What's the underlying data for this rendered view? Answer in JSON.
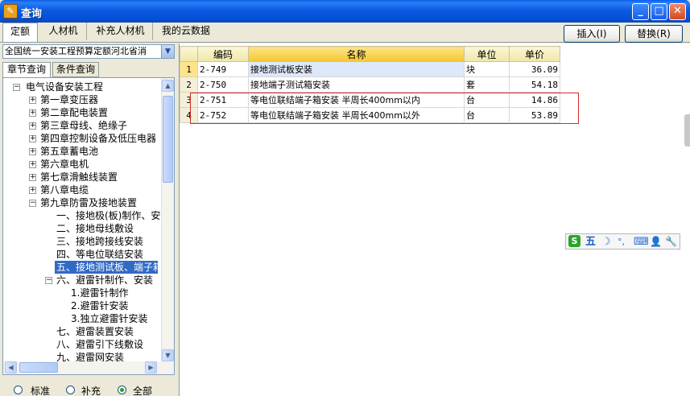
{
  "window": {
    "title": "查询",
    "minimize": "_",
    "maximize": "□",
    "close": "✕"
  },
  "tabs": [
    {
      "label": "定额",
      "active": true
    },
    {
      "label": "人材机",
      "active": false
    },
    {
      "label": "补充人材机",
      "active": false
    },
    {
      "label": "我的云数据",
      "active": false
    }
  ],
  "toolbar": {
    "insert_label": "插入(I)",
    "replace_label": "替换(R)"
  },
  "left": {
    "quota_select": "全国统一安装工程预算定额河北省消",
    "subtabs": [
      "章节查询",
      "条件查询"
    ],
    "tree": {
      "root": "电气设备安装工程",
      "chapters": [
        "第一章变压器",
        "第二章配电装置",
        "第三章母线、绝缘子",
        "第四章控制设备及低压电器",
        "第五章蓄电池",
        "第六章电机",
        "第七章滑触线装置",
        "第八章电缆",
        "第九章防雷及接地装置"
      ],
      "sections": [
        "一、接地极(板)制作、安",
        "二、接地母线敷设",
        "三、接地跨接线安装",
        "四、等电位联结安装",
        "五、接地测试板、端子箱",
        "六、避雷针制作、安装"
      ],
      "subsections": [
        "1.避雷针制作",
        "2.避雷针安装",
        "3.独立避雷针安装"
      ],
      "more_sections": [
        "七、避雷装置安装",
        "八、避雷引下线敷设",
        "九、避雷网安装"
      ]
    },
    "radios": [
      {
        "label": "标准",
        "checked": false
      },
      {
        "label": "补充",
        "checked": false
      },
      {
        "label": "全部",
        "checked": true
      }
    ]
  },
  "grid": {
    "headers": [
      "编码",
      "名称",
      "单位",
      "单价"
    ],
    "rows": [
      {
        "no": "1",
        "code": "2-749",
        "name": "接地测试板安装",
        "unit": "块",
        "price": "36.09"
      },
      {
        "no": "2",
        "code": "2-750",
        "name": "接地端子测试箱安装",
        "unit": "套",
        "price": "54.18"
      },
      {
        "no": "3",
        "code": "2-751",
        "name": "等电位联结端子箱安装 半周长400mm以内",
        "unit": "台",
        "price": "14.86"
      },
      {
        "no": "4",
        "code": "2-752",
        "name": "等电位联结端子箱安装 半周长400mm以外",
        "unit": "台",
        "price": "53.89"
      }
    ]
  },
  "ime": {
    "logo": "S",
    "mode": "五",
    "moon": "☽",
    "punct": "°,",
    "keyboard": "⌨",
    "user": "👤",
    "tool": "🔧"
  },
  "colors": {
    "titlebar": "#0a5ee8",
    "selection": "#316ac5",
    "highlight": "#d62828"
  }
}
